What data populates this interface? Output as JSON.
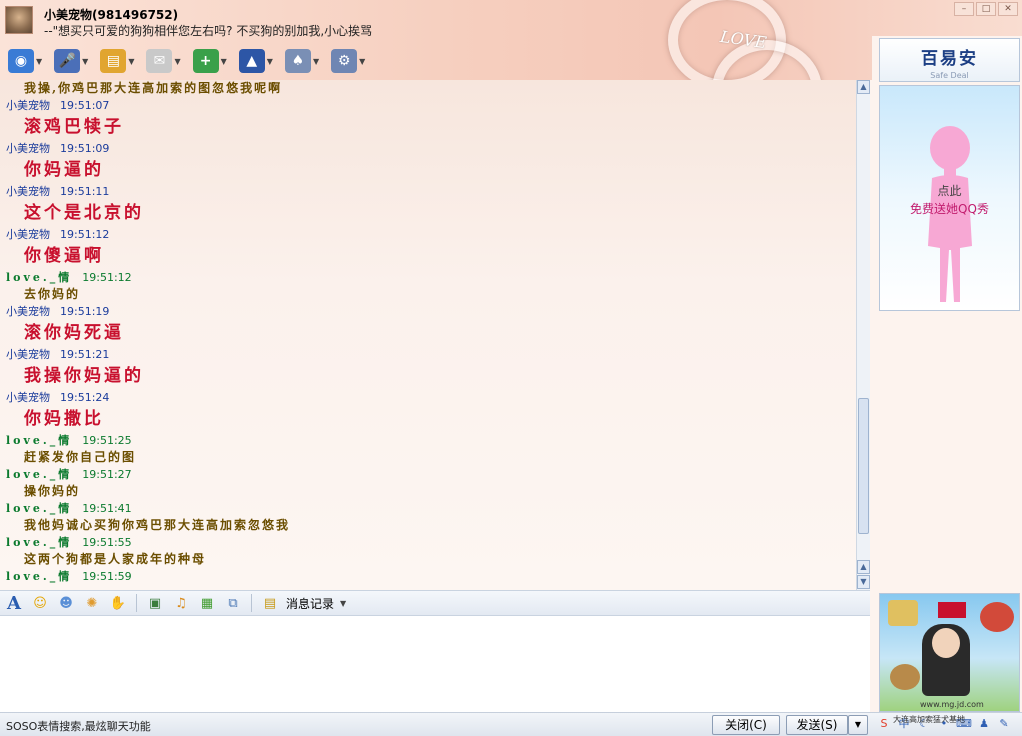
{
  "header": {
    "contact_name": "小美宠物(981496752)",
    "status_message": "--\"想买只可爱的狗狗相伴您左右吗? 不买狗的别加我,小心挨骂",
    "decoration_text": "LOVE"
  },
  "toolbar": {
    "items": [
      {
        "name": "video-call",
        "icon": "webcam-icon",
        "color": "#3a7bd5",
        "glyph": "◉"
      },
      {
        "name": "voice-call",
        "icon": "microphone-icon",
        "color": "#4b6fb8",
        "glyph": "🎤"
      },
      {
        "name": "send-file",
        "icon": "folder-icon",
        "color": "#e1a530",
        "glyph": "▤"
      },
      {
        "name": "send-sms",
        "icon": "message-icon",
        "color": "#c9c9c9",
        "glyph": "✉"
      },
      {
        "name": "create-group",
        "icon": "add-discussion-icon",
        "color": "#3aa04a",
        "glyph": "+"
      },
      {
        "name": "remote-assist",
        "icon": "police-hat-icon",
        "color": "#2d56a6",
        "glyph": "▲"
      },
      {
        "name": "apps",
        "icon": "cards-icon",
        "color": "#7a8fb5",
        "glyph": "♠"
      },
      {
        "name": "settings",
        "icon": "gear-icon",
        "color": "#6f86b3",
        "glyph": "⚙"
      }
    ]
  },
  "messages": [
    {
      "type": "text",
      "size": "small",
      "text": "我操,你鸡巴那大连高加索的图忽悠我呢啊"
    },
    {
      "type": "meta",
      "who": "pet",
      "sender": "小美宠物",
      "time": "19:51:07"
    },
    {
      "type": "text",
      "size": "big",
      "text": "滚鸡巴犊子"
    },
    {
      "type": "meta",
      "who": "pet",
      "sender": "小美宠物",
      "time": "19:51:09"
    },
    {
      "type": "text",
      "size": "big",
      "text": "你妈逼的"
    },
    {
      "type": "meta",
      "who": "pet",
      "sender": "小美宠物",
      "time": "19:51:11"
    },
    {
      "type": "text",
      "size": "big",
      "text": "这个是北京的"
    },
    {
      "type": "meta",
      "who": "pet",
      "sender": "小美宠物",
      "time": "19:51:12"
    },
    {
      "type": "text",
      "size": "big",
      "text": "你傻逼啊"
    },
    {
      "type": "meta",
      "who": "love",
      "sender": "love._情",
      "time": "19:51:12"
    },
    {
      "type": "text",
      "size": "small",
      "text": "去你妈的"
    },
    {
      "type": "meta",
      "who": "pet",
      "sender": "小美宠物",
      "time": "19:51:19"
    },
    {
      "type": "text",
      "size": "big",
      "text": "滚你妈死逼"
    },
    {
      "type": "meta",
      "who": "pet",
      "sender": "小美宠物",
      "time": "19:51:21"
    },
    {
      "type": "text",
      "size": "big",
      "text": "我操你妈逼的"
    },
    {
      "type": "meta",
      "who": "pet",
      "sender": "小美宠物",
      "time": "19:51:24"
    },
    {
      "type": "text",
      "size": "big",
      "text": "你妈撒比"
    },
    {
      "type": "meta",
      "who": "love",
      "sender": "love._情",
      "time": "19:51:25"
    },
    {
      "type": "text",
      "size": "small",
      "text": "赶紧发你自己的图"
    },
    {
      "type": "meta",
      "who": "love",
      "sender": "love._情",
      "time": "19:51:27"
    },
    {
      "type": "text",
      "size": "small",
      "text": "操你妈的"
    },
    {
      "type": "meta",
      "who": "love",
      "sender": "love._情",
      "time": "19:51:41"
    },
    {
      "type": "text",
      "size": "small",
      "text": "我他妈诚心买狗你鸡巴那大连高加索忽悠我"
    },
    {
      "type": "meta",
      "who": "love",
      "sender": "love._情",
      "time": "19:51:55"
    },
    {
      "type": "text",
      "size": "small",
      "text": "这两个狗都是人家成年的种母"
    },
    {
      "type": "meta",
      "who": "love",
      "sender": "love._情",
      "time": "19:51:59"
    }
  ],
  "input_toolbar": {
    "font_glyph": "A",
    "icons": [
      {
        "name": "emoji",
        "icon": "smiley-icon",
        "glyph": "☺",
        "color": "#e5a500"
      },
      {
        "name": "magic-emoji",
        "icon": "magic-face-icon",
        "glyph": "☻",
        "color": "#5a8fd6"
      },
      {
        "name": "nudge",
        "icon": "shake-icon",
        "glyph": "✺",
        "color": "#e09b2f"
      },
      {
        "name": "doodle",
        "icon": "hand-icon",
        "glyph": "✋",
        "color": "#d38b28"
      },
      {
        "name": "send-image",
        "icon": "image-icon",
        "glyph": "▣",
        "color": "#3b7d3b"
      },
      {
        "name": "music",
        "icon": "music-icon",
        "glyph": "♫",
        "color": "#d98b1c"
      },
      {
        "name": "gift",
        "icon": "gift-icon",
        "glyph": "▦",
        "color": "#3f9b2d"
      },
      {
        "name": "screenshot",
        "icon": "screenshot-icon",
        "glyph": "⧉",
        "color": "#4a77b5"
      }
    ],
    "history_label": "消息记录"
  },
  "input": {
    "value": ""
  },
  "bottom_bar": {
    "tip": "SOSO表情搜索,最炫聊天功能",
    "close_label": "关闭(C)",
    "send_label": "发送(S)",
    "tray_icons": [
      {
        "icon": "sogou-s-icon",
        "glyph": "S",
        "color": "#e23c2a"
      },
      {
        "icon": "chinese-mode-icon",
        "glyph": "中",
        "color": "#2f5fb3"
      },
      {
        "icon": "moon-icon",
        "glyph": "☾",
        "color": "#2f5fb3"
      },
      {
        "icon": "dot-icon",
        "glyph": "•",
        "color": "#2f5fb3"
      },
      {
        "icon": "keyboard-icon",
        "glyph": "⌨",
        "color": "#2f5fb3"
      },
      {
        "icon": "user-icon",
        "glyph": "♟",
        "color": "#2f5fb3"
      },
      {
        "icon": "wrench-icon",
        "glyph": "✎",
        "color": "#2f5fb3"
      }
    ]
  },
  "right_panel": {
    "brand_name": "百易安",
    "brand_subtitle": "Safe Deal",
    "qqshow_line1": "点此",
    "qqshow_line2": "免费送她QQ秀",
    "ad_url": "www.mg.jd.com",
    "ad_slogan": "大连高加索猛犬基地"
  },
  "colors": {
    "pet_sender": "#1b3c9c",
    "love_sender": "#0b7a2e",
    "big_text": "#c8102e",
    "small_text": "#6b4e00"
  }
}
